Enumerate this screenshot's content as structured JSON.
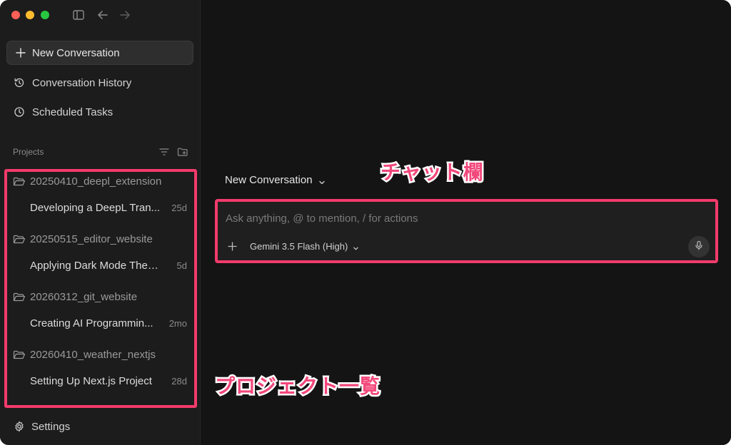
{
  "sidebar": {
    "new_conversation": "New Conversation",
    "conversation_history": "Conversation History",
    "scheduled_tasks": "Scheduled Tasks",
    "projects_label": "Projects",
    "projects": [
      {
        "name": "20250410_deepl_extension",
        "conversation": "Developing a DeepL Tran...",
        "age": "25d"
      },
      {
        "name": "20250515_editor_website",
        "conversation": "Applying Dark Mode Theme",
        "age": "5d"
      },
      {
        "name": "20260312_git_website",
        "conversation": "Creating AI Programmin...",
        "age": "2mo"
      },
      {
        "name": "20260410_weather_nextjs",
        "conversation": "Setting Up Next.js Project",
        "age": "28d"
      }
    ],
    "settings": "Settings"
  },
  "main": {
    "conversation_title": "New Conversation",
    "chat_placeholder": "Ask anything, @ to mention, / for actions",
    "model": "Gemini 3.5 Flash (High)"
  },
  "annotations": {
    "chat": "チャット欄",
    "projects": "プロジェクト一覧"
  },
  "icons": {
    "plus": "plus-icon",
    "history": "history-icon",
    "clock": "clock-icon",
    "filter": "filter-icon",
    "new_folder": "folder-plus-icon",
    "folder": "folder-open-icon",
    "gear": "gear-icon",
    "mic": "microphone-icon",
    "sidebar_toggle": "sidebar-toggle-icon",
    "back": "arrow-left-icon",
    "forward": "arrow-right-icon"
  },
  "colors": {
    "annotation": "#f23b6c",
    "background": "#141414",
    "sidebar": "#1c1c1c"
  }
}
